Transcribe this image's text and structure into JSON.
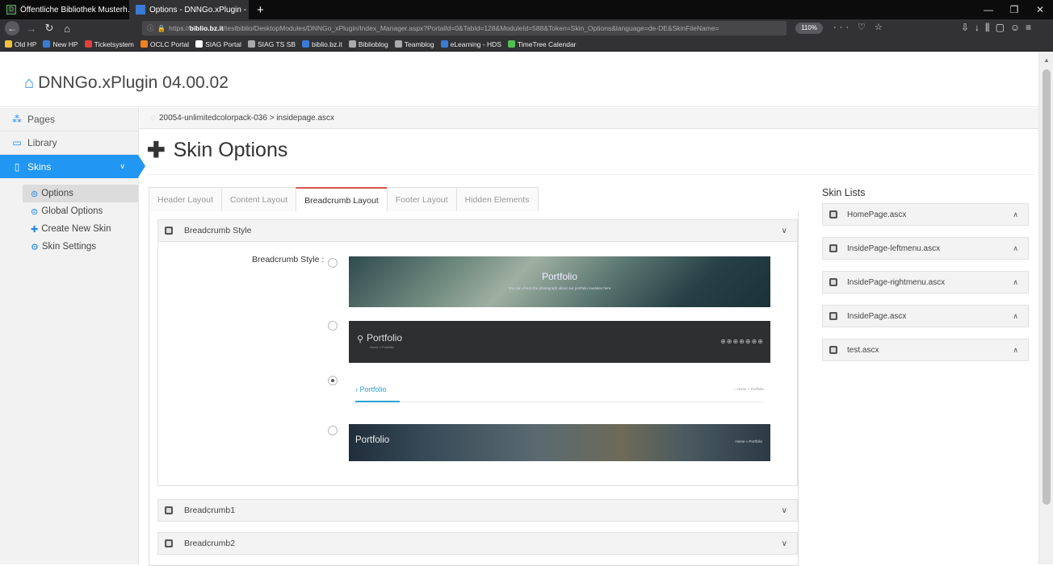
{
  "browser": {
    "tabs": [
      {
        "title": "Öffentliche Bibliothek Musterh…",
        "close": "✕",
        "favicon_color": "#2a2a2a"
      },
      {
        "title": "Options - DNNGo.xPlugin - xP…",
        "close": "✕",
        "favicon_color": "#3a7bd5"
      }
    ],
    "new_tab": "+",
    "window_controls": [
      "—",
      "❐",
      "✕"
    ],
    "url_prefix": "https://",
    "url_host": "biblio.bz.it",
    "url_path": "/testbiblio/DesktopModules/DNNGo_xPlugin/Index_Manager.aspx?PortalId=0&TabId=128&ModuleId=588&Token=Skin_Options&language=de-DE&SkinFileName=",
    "zoom": "110%",
    "bookmarks": [
      {
        "label": "Old HP",
        "color": "#f0c040"
      },
      {
        "label": "New HP",
        "color": "#3a7bd5"
      },
      {
        "label": "Ticketsystem",
        "color": "#e04040"
      },
      {
        "label": "OCLC Portal",
        "color": "#f08020"
      },
      {
        "label": "SIAG Portal",
        "color": "#ffffff"
      },
      {
        "label": "SIAG TS SB",
        "color": "#aaaaaa"
      },
      {
        "label": "biblio.bz.it",
        "color": "#3a7bd5"
      },
      {
        "label": "Biblioblog",
        "color": "#aaaaaa"
      },
      {
        "label": "Teamblog",
        "color": "#aaaaaa"
      },
      {
        "label": "eLearning - HDS",
        "color": "#3a7bd5"
      },
      {
        "label": "TimeTree Calendar",
        "color": "#50c050"
      }
    ]
  },
  "app": {
    "title": "DNNGo.xPlugin 04.00.02",
    "accent": "#2196f3"
  },
  "sidebar": {
    "items": [
      {
        "label": "Pages",
        "icon": "sitemap-icon"
      },
      {
        "label": "Library",
        "icon": "image-icon"
      },
      {
        "label": "Skins",
        "icon": "book-icon",
        "active": true
      }
    ],
    "sub_items": [
      {
        "label": "Options",
        "icon": "database-icon",
        "selected": true
      },
      {
        "label": "Global Options",
        "icon": "database-icon"
      },
      {
        "label": "Create New Skin",
        "icon": "plus-icon"
      },
      {
        "label": "Skin Settings",
        "icon": "gear-icon"
      }
    ]
  },
  "breadcrumb": "20054-unlimitedcolorpack-036 > insidepage.ascx",
  "page_title": "Skin Options",
  "tabs": [
    "Header Layout",
    "Content Layout",
    "Breadcrumb Layout",
    "Footer Layout",
    "Hidden Elements"
  ],
  "active_tab": "Breadcrumb Layout",
  "panels": {
    "breadcrumb_style": {
      "title": "Breadcrumb Style",
      "label": "Breadcrumb Style :",
      "options": [
        {
          "title": "Portfolio",
          "subtitle": "You can check the photograph about our portfolio modules here",
          "selected": false
        },
        {
          "title": "Portfolio",
          "subtitle": "Home  »  Portfolio",
          "icons": "⊕⊕⊕⊕⊕⊕⊕",
          "selected": false
        },
        {
          "title": "› Portfolio",
          "subtitle": "⌂ Home  »  Portfolio",
          "selected": true
        },
        {
          "title": "Portfolio",
          "subtitle": "Home  »  Portfolio",
          "selected": false
        }
      ]
    },
    "collapsed": [
      "Breadcrumb1",
      "Breadcrumb2"
    ]
  },
  "skin_lists": {
    "title": "Skin Lists",
    "items": [
      "HomePage.ascx",
      "InsidePage-leftmenu.ascx",
      "InsidePage-rightmenu.ascx",
      "InsidePage.ascx",
      "test.ascx"
    ]
  }
}
